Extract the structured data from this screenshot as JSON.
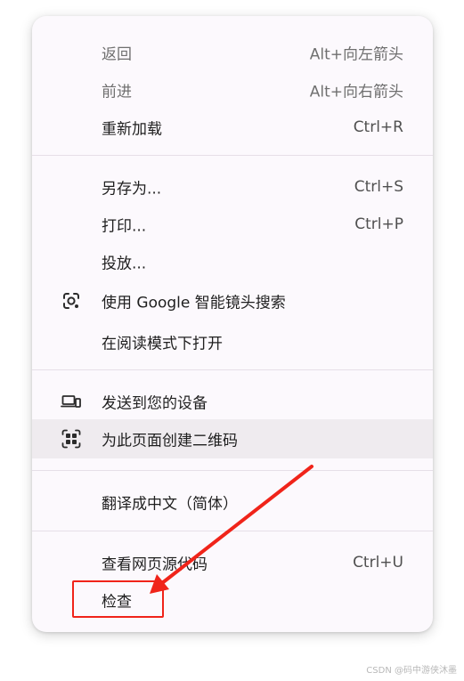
{
  "menu": {
    "items": [
      {
        "label": "返回",
        "shortcut": "Alt+向左箭头"
      },
      {
        "label": "前进",
        "shortcut": "Alt+向右箭头"
      },
      {
        "label": "重新加载",
        "shortcut": "Ctrl+R"
      },
      {
        "label": "另存为...",
        "shortcut": "Ctrl+S"
      },
      {
        "label": "打印...",
        "shortcut": "Ctrl+P"
      },
      {
        "label": "投放..."
      },
      {
        "label": "使用 Google 智能镜头搜索",
        "icon": "google-lens-icon"
      },
      {
        "label": "在阅读模式下打开"
      },
      {
        "label": "发送到您的设备",
        "icon": "devices-icon"
      },
      {
        "label": "为此页面创建二维码",
        "icon": "qr-code-icon"
      },
      {
        "label": "翻译成中文（简体）"
      },
      {
        "label": "查看网页源代码",
        "shortcut": "Ctrl+U"
      },
      {
        "label": "检查"
      }
    ]
  },
  "annotation": {
    "color": "#f0241a"
  },
  "colors": {
    "menu_background": "#fcf9fd",
    "highlight": "#efebef",
    "text": "#1f1f1f",
    "disabled_text": "#6f6f6f",
    "divider": "#e6dfe8"
  },
  "watermark": "CSDN @码中游侠沐墨"
}
